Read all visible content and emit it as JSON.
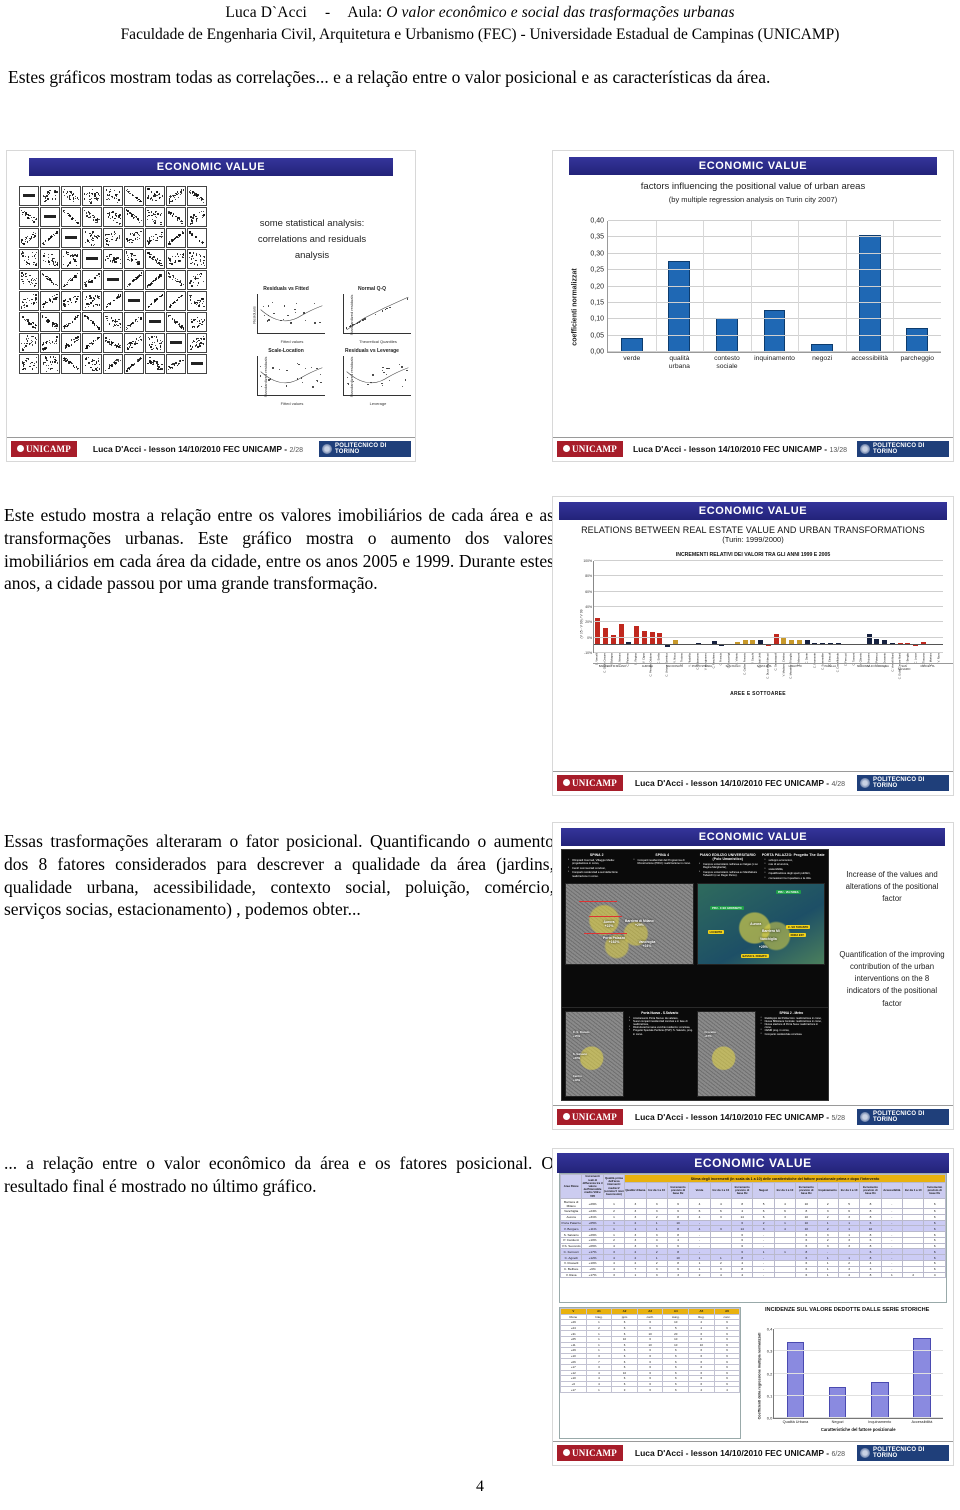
{
  "header": {
    "author": "Luca D`Acci",
    "dash": "-",
    "lesson_label": "Aula:",
    "lesson_title": "O valor econômico e social das trasformações urbanas",
    "institution": "Faculdade de Engenharia Civil, Arquitetura e Urbanismo (FEC) - Universidade Estadual de Campinas (UNICAMP)"
  },
  "paragraphs": {
    "intro": "Estes gráficos mostram todas as correlações... e a relação entre o valor posicional e as características da área.",
    "p2": "Este estudo mostra a relação entre os valores imobiliários de cada área e as transformações urbanas. Este gráfico mostra o aumento dos valores imobiliários em cada área da cidade, entre os anos 2005 e 1999. Durante estes anos, a cidade passou por uma grande transformação.",
    "p3": "Essas trasformações alteraram o fator posicional. Quantificando o aumento dos 8 fatores considerados para descrever a qualidade da área (jardins, qualidade urbana, acessibilidade, contexto social, poluição, comércio, serviços socias, estacionamento) , podemos obter...",
    "p4": "... a relação entre o valor econômico da área e os fatores posicional. O resultado final é mostrado no último gráfico."
  },
  "page_number": "4",
  "colors": {
    "slide_header_blue": "#2b2b8f",
    "bar_blue": "#1f68b4",
    "bar_purple": "#8a8ae0",
    "bar_red": "#c0281e",
    "bar_gold": "#c8992a",
    "bar_navy": "#16213f",
    "unicamp_red": "#a71d2a",
    "polito_blue": "#1f3f7a",
    "table_gold": "#e8b10e",
    "table_lilac": "#ccccf0"
  },
  "slide_footer": {
    "unicamp_label": "UNICAMP",
    "polito_label": "POLITECNICO DI TORINO",
    "credit": "Luca D'Acci  -   lesson 14/10/2010  FEC UNICAMP   -",
    "slide1_no": "2/28",
    "slide2_no": "13/28",
    "slide3_no": "4/28",
    "slide4_no": "5/28",
    "slide5_no": "6/28"
  },
  "slide1": {
    "title": "ECONOMIC VALUE",
    "caption_line1": "some statistical analysis:",
    "caption_line2": "correlations and residuals",
    "caption_line3": "analysis",
    "ellipsis": "· · ·",
    "diagnostics": [
      {
        "title": "Residuals vs Fitted",
        "xlabel": "Fitted values",
        "ylabel": "Residuals"
      },
      {
        "title": "Normal Q-Q",
        "xlabel": "Theoretical Quantiles",
        "ylabel": "Standardized residuals"
      },
      {
        "title": "Scale-Location",
        "xlabel": "Fitted values",
        "ylabel": "Standardized residuals"
      },
      {
        "title": "Residuals vs Leverage",
        "xlabel": "Leverage",
        "ylabel": "Standardized residuals"
      }
    ],
    "matrix_size": 9
  },
  "chart_data": [
    {
      "id": "slide2_bar",
      "type": "bar",
      "title": "factors influencing the positional value of urban areas",
      "subtitle": "(by multiple regression analysis on Turin city 2007)",
      "xlabel": "",
      "ylabel": "coefficienti normalizzat",
      "categories": [
        "verde",
        "qualità urbana",
        "contesto sociale",
        "inquinamento",
        "negozi",
        "accessibilità",
        "parcheggio"
      ],
      "values": [
        0.043,
        0.277,
        0.104,
        0.128,
        0.025,
        0.356,
        0.072
      ],
      "ylim": [
        0.0,
        0.4
      ],
      "yticks": [
        "0,00",
        "0,05",
        "0,10",
        "0,15",
        "0,20",
        "0,25",
        "0,30",
        "0,35",
        "0,40"
      ],
      "grid": true,
      "legend": "none",
      "color": "#1f68b4"
    },
    {
      "id": "slide3_increments",
      "type": "bar",
      "title": "RELATIONS BETWEEN REAL ESTATE VALUE AND URBAN TRANSFORMATIONS",
      "subtitle": "(Turin: 1999/2000)",
      "chart_title": "INCREMENTI RELATIVI DEI VALORI TRA GLI ANNI 1999 E 2005",
      "xlabel": "AREE E SOTTOAREE",
      "ylabel": "(V 05 - V 99) / V 99",
      "ylim": [
        -10,
        100
      ],
      "yticks": [
        "100%",
        "80%",
        "60%",
        "40%",
        "20%",
        "0%",
        "-10%"
      ],
      "grid": true,
      "groups": [
        "BARRIERA DI MILANO",
        "AURORA",
        "SAN DONATO",
        "POZZO STRADA",
        "SAN PAOLO",
        "SANTA RITA",
        "LINGOTTO",
        "PARELLA",
        "MADONNA DI CAMPAGNA",
        "SAN SALVARIO",
        "CROCETTA",
        "CENTRO",
        "BORGO VITTORIA",
        "VANCHIGLIA"
      ],
      "group_spans": [
        5,
        4,
        3,
        4,
        4,
        4,
        4,
        5,
        6,
        2,
        4,
        6,
        3,
        3
      ],
      "categories": [
        "C. Vercelli",
        "C. Giulio Cesare",
        "V. Bologna",
        "C. Novara",
        "C. Palermo",
        "C. Regina",
        "V. Cigna",
        "C. Principe Oddone",
        "C. Emilia",
        "C. Unione Sovietica",
        "V. Nizza",
        "C. Traiano",
        "V. Filadelfia",
        "C. Orbassano",
        "V. Monginevro",
        "C. Peschiera",
        "C. Francia",
        "C. Racconigi",
        "C. Vittorio",
        "C. Galileo Ferraris",
        "V. Sacchi",
        "C. Stati Uniti",
        "C. Duca degli Abruzzi",
        "C. Sebastopoli",
        "V. Madama Cristina",
        "C. Massimo d'Azeglio",
        "C. Marconi",
        "C. Dante",
        "C. Bramante",
        "C. Sommeiller",
        "C. Einaudi",
        "C. Castelfidardo",
        "C. Ferrucci",
        "C. Tassoni",
        "V. Cibrario",
        "C. Svizzera",
        "C. Potenza",
        "C. Grosseto",
        "C. Vercelli Nord",
        "C. Giulio Cesare Nord",
        "V. Breglio",
        "C. Lecce",
        "C. Toscana",
        "C. Mortara",
        "V. Rava"
      ],
      "values": [
        32,
        20,
        11,
        25,
        3,
        22,
        16,
        15,
        14,
        -3,
        6,
        1,
        1,
        2,
        1,
        4,
        -2,
        1,
        3,
        5,
        5,
        5,
        -1,
        13,
        9,
        6,
        6,
        6,
        2,
        2,
        2,
        2,
        1,
        1,
        1,
        13,
        7,
        5,
        2,
        2,
        2,
        -1,
        3,
        1,
        1
      ],
      "colors": [
        "red",
        "red",
        "red",
        "red",
        "navy",
        "red",
        "red",
        "red",
        "red",
        "navy",
        "gold",
        "navy",
        "navy",
        "navy",
        "navy",
        "navy",
        "navy",
        "gold",
        "gold",
        "gold",
        "gold",
        "navy",
        "red",
        "red",
        "gold",
        "gold",
        "gold",
        "navy",
        "navy",
        "navy",
        "navy",
        "navy",
        "red",
        "gold",
        "gold",
        "navy",
        "navy",
        "navy",
        "navy",
        "red",
        "red",
        "red",
        "red",
        "red",
        "navy"
      ]
    },
    {
      "id": "slide5_bar",
      "type": "bar",
      "title": "INCIDENZE SUL VALORE DEDOTTE DALLE SERIE STORICHE",
      "xlabel": "Caratteristiche del fattore posizionale",
      "ylabel": "Coefficienti della regressione multipla normalizzati",
      "categories": [
        "Qualità Urbana",
        "Negozi",
        "Inquinamento",
        "Accessibilità"
      ],
      "values": [
        0.34,
        0.14,
        0.16,
        0.36
      ],
      "ylim": [
        0.0,
        0.4
      ],
      "yticks": [
        "0,0",
        "0,1",
        "0,2",
        "0,3",
        "0,4"
      ],
      "grid": true,
      "color": "#8a8ae0"
    }
  ],
  "slide2": {
    "title": "ECONOMIC VALUE"
  },
  "slide3": {
    "title": "ECONOMIC VALUE"
  },
  "slide4": {
    "title": "ECONOMIC VALUE",
    "columns": [
      {
        "heading": "SPINA 2",
        "items": [
          "Olimpiadi Invernali, Villaggio Media: progettazione in corso,",
          "Centri commerciali conclusi,",
          "Comparti residenziali a sud della Dora: realizzazione in corso."
        ]
      },
      {
        "heading": "SPINA 4",
        "items": [
          "Comparti residenziali del Programma di Ricostruzione (PRIU): realizzazione in corso."
        ]
      },
      {
        "heading": "PIANO EDILIZIO UNIVERSITARIO (Polo Umanistico)",
        "items": [
          "Campus universitario nell'area ex Italgas (c.so Regina Margherita),",
          "Campus universitario nell'area ex Manifattura Tabacchi (c.so Regio Parco)."
        ]
      },
      {
        "heading": "PORTA PALAZZO: Progetto The Gate",
        "items": [
          "sviluppo economico,",
          "rete di sicurezza,",
          "sostenibilità,",
          "riqualificazione degli spazi pubblici,",
          "connessioni tra il quartiere e la città."
        ]
      }
    ],
    "map_left_labels": [
      {
        "text": "Aurora +22%"
      },
      {
        "text": "Barriera di Milano +29%"
      },
      {
        "text": "Porta Palazzo +162%"
      },
      {
        "text": "Vanchiglia +24%"
      }
    ],
    "map_right_title": "PROGETTO SPECIALE PERIFERIE (PSP)",
    "map_right_labels": [
      {
        "text": "Aurora"
      },
      {
        "text": "Barriera Mi"
      },
      {
        "text": "Vanchiglia"
      },
      {
        "text": "+25%"
      }
    ],
    "map_right_tags": [
      "PRU - VIA IVREA",
      "PRU - C.SO GROSSETO",
      "C. SO TARANTO",
      "LUCENTO",
      "DORA EST",
      "BASSO S. DONATO"
    ],
    "bottom_panels": [
      {
        "heading": "Porta Nuova - S.Salvario",
        "items": [
          "Arretramento Porta Nuova: da valutare,",
          "Nuovi comparti residenziali conclusi e in fase di realizzazione,",
          "Ristrutturazioni aree vecchie residenze: conclusa,",
          "Progetto Speciale Periferie (PSP): S. Salvario, prog. in corso."
        ],
        "map_labels": [
          "C. S. Donato +15%",
          "S. Salvario +30%",
          "Centro +19%"
        ]
      },
      {
        "heading": "SPINA 2 - Metro",
        "items": [
          "Raddoppio del Politecnico: realizzazione in corso,",
          "Nuova Biblioteca Centrale: realizzazione in corso,",
          "Nuova stazione di Porta Susa: realizzazione in corso,",
          "CEMR prog. in corso,",
          "Comparto residenziale conclusa."
        ],
        "map_labels": [
          "Crocetta +17%"
        ]
      }
    ],
    "right_text_1": "Increase of the values and alterations of the positional factor",
    "right_text_2": "Quantification of the improving contribution  of the urban interventions on the 8 indicators of the positional factor"
  },
  "slide5": {
    "title": "ECONOMIC VALUE",
    "table": {
      "banner": "Stima degli incrementi (in scala da 1 a 10) delle caratteristiche del fattore posizionale prima e dopo l'intervento",
      "header_left": [
        "Aree Rione",
        "Incrementi reali di differenza tra il valore dell'immobile medio V99 e V05",
        "Qualità prima dell'area interventi: media=2 (somma 5 rioni buonissimi)"
      ],
      "group_headers": [
        "Qualità Urbana",
        "Verde",
        "Negozi",
        "Inquinamento",
        "Accessibilità"
      ],
      "sub_headers": [
        "Inc da 1 a 10",
        "Incremento previsto di base Dx"
      ],
      "rows": [
        {
          "name": "Barriera di Milano",
          "incr": "+29%",
          "q": "1",
          "cells": [
            "3",
            "3",
            "6",
            "4",
            "4",
            "8",
            "5",
            "4",
            "10",
            "2",
            "5",
            "8",
            "-",
            "",
            "6"
          ]
        },
        {
          "name": "Vanchiglia",
          "incr": "+24%",
          "q": "2",
          "cells": [
            "3",
            "3",
            "6",
            "6",
            "6",
            "4",
            "6",
            "6",
            "8",
            "3",
            "6",
            "8",
            "-",
            "",
            "6"
          ]
        },
        {
          "name": "Aurora",
          "incr": "+31%",
          "q": "1",
          "cells": [
            "3",
            "2",
            "8",
            "4",
            "3",
            "14",
            "6",
            "3",
            "10",
            "2",
            "3",
            "8",
            "-",
            "",
            "6"
          ]
        },
        {
          "name": "Porta Palazzo",
          "incr": "+65%",
          "q": "1",
          "cells": [
            "2",
            "1",
            "10",
            "-",
            "",
            "6",
            "2",
            "1",
            "10",
            "1",
            "1",
            "6",
            "-",
            "",
            "6"
          ]
        },
        {
          "name": "V. Borgaro",
          "incr": "+11%",
          "q": "1",
          "cells": [
            "1",
            "1",
            "8",
            "4",
            "3",
            "14",
            "3",
            "4",
            "10",
            "2",
            "1",
            "10",
            "-",
            "",
            "6"
          ]
        },
        {
          "name": "S. Salvario",
          "incr": "+29%",
          "q": "1",
          "cells": [
            "3",
            "3",
            "8",
            "-",
            "",
            "6",
            "-",
            "",
            "6",
            "3",
            "1",
            "8",
            "-",
            "",
            "6"
          ]
        },
        {
          "name": "P. Carducci",
          "incr": "+10%",
          "q": "2",
          "cells": [
            "3",
            "4",
            "4",
            "-",
            "",
            "6",
            "-",
            "",
            "6",
            "2",
            "3",
            "6",
            "-",
            "",
            "6"
          ]
        },
        {
          "name": "V.S. Secondo",
          "incr": "+06%",
          "q": "4",
          "cells": [
            "3",
            "3",
            "6",
            "-",
            "",
            "6",
            "-",
            "",
            "6",
            "3",
            "3",
            "8",
            "-",
            "",
            "6"
          ]
        },
        {
          "name": "C. Ferrucci",
          "incr": "+17%",
          "q": "3",
          "cells": [
            "2",
            "2",
            "8",
            "-",
            "",
            "6",
            "1",
            "1",
            "8",
            "-",
            "",
            "6",
            "-",
            "",
            "6"
          ]
        },
        {
          "name": "C. Agnelli",
          "incr": "+12%",
          "q": "4",
          "cells": [
            "2",
            "1",
            "10",
            "1",
            "1",
            "8",
            "-",
            "",
            "6",
            "1",
            "1",
            "8",
            "-",
            "",
            "6"
          ]
        },
        {
          "name": "V. Rosselli",
          "incr": "+10%",
          "q": "4",
          "cells": [
            "2",
            "2",
            "8",
            "1",
            "2",
            "4",
            "-",
            "",
            "6",
            "1",
            "2",
            "4",
            "-",
            "",
            "6"
          ]
        },
        {
          "name": "C. Belfiore",
          "incr": "+6%",
          "q": "4",
          "cells": [
            "7",
            "3",
            "6",
            "1",
            "3",
            "8",
            "-",
            "",
            "6",
            "1",
            "3",
            "3",
            "-",
            "",
            "6"
          ]
        },
        {
          "name": "V. Rava",
          "incr": "+17%",
          "q": "3",
          "cells": [
            "1",
            "3",
            "3",
            "2",
            "4",
            "4",
            "-",
            "",
            "6",
            "1",
            "4",
            "8",
            "1",
            "2",
            "4"
          ]
        }
      ]
    },
    "mini_table": {
      "gold_header": [
        "V",
        "A1",
        "A2",
        "A3",
        "A4",
        "A5",
        "A6"
      ],
      "sub_header": [
        "Rione",
        "Integ.",
        "ppm",
        "confr.",
        "Aung.",
        "Reg.",
        "conc."
      ],
      "rows": [
        [
          "+29",
          "1",
          "6",
          "6",
          "10",
          "2",
          "6"
        ],
        [
          "+24",
          "2",
          "6",
          "6",
          "5",
          "2",
          "6"
        ],
        [
          "+31",
          "1",
          "6",
          "10",
          "20",
          "6",
          "6"
        ],
        [
          "+65",
          "1",
          "10",
          "6",
          "10",
          "6",
          "6"
        ],
        [
          "+11",
          "1",
          "6",
          "10",
          "10",
          "10",
          "6"
        ],
        [
          "+29",
          "1",
          "6",
          "6",
          "6",
          "6",
          "6"
        ],
        [
          "+10",
          "3",
          "6",
          "6",
          "6",
          "6",
          "6"
        ],
        [
          "+06",
          "7",
          "6",
          "6",
          "6",
          "6",
          "6"
        ],
        [
          "+17",
          "3",
          "6",
          "6",
          "6",
          "6",
          "6"
        ],
        [
          "+12",
          "4",
          "10",
          "6",
          "6",
          "6",
          "6"
        ],
        [
          "+10",
          "4",
          "6",
          "6",
          "6",
          "6",
          "6"
        ],
        [
          "+6",
          "4",
          "6",
          "6",
          "6",
          "6",
          "6"
        ],
        [
          "+17",
          "1",
          "3",
          "6",
          "6",
          "2",
          "4"
        ]
      ]
    }
  }
}
